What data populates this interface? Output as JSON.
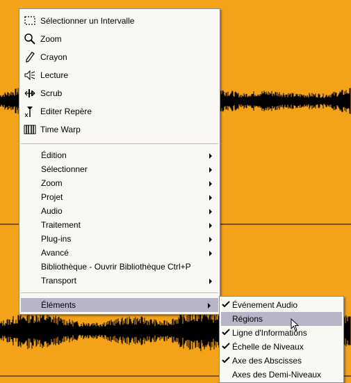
{
  "colors": {
    "waveform_bg": "#f5a21b",
    "waveform": "#000000",
    "menu_bg": "#f9f8f4",
    "highlight": "#b6b6c8"
  },
  "tools": [
    {
      "label": "Sélectionner un Intervalle",
      "icon": "range-select-icon"
    },
    {
      "label": "Zoom",
      "icon": "magnifier-icon"
    },
    {
      "label": "Crayon",
      "icon": "pencil-icon"
    },
    {
      "label": "Lecture",
      "icon": "speaker-icon"
    },
    {
      "label": "Scrub",
      "icon": "scrub-icon"
    },
    {
      "label": "Editer Repère",
      "icon": "marker-icon"
    },
    {
      "label": "Time Warp",
      "icon": "time-warp-icon"
    }
  ],
  "menu_items": [
    {
      "label": "Édition",
      "submenu": true
    },
    {
      "label": "Sélectionner",
      "submenu": true
    },
    {
      "label": "Zoom",
      "submenu": true
    },
    {
      "label": "Projet",
      "submenu": true
    },
    {
      "label": "Audio",
      "submenu": true
    },
    {
      "label": "Traitement",
      "submenu": true
    },
    {
      "label": "Plug-ins",
      "submenu": true
    },
    {
      "label": "Avancé",
      "submenu": true
    },
    {
      "label": "Bibliothèque - Ouvrir Bibliothèque",
      "shortcut": "Ctrl+P",
      "submenu": false
    },
    {
      "label": "Transport",
      "submenu": true
    }
  ],
  "elements_item": {
    "label": "Éléments",
    "submenu": true,
    "highlighted": true
  },
  "submenu_items": [
    {
      "label": "Événement Audio",
      "checked": true
    },
    {
      "label": "Régions",
      "checked": false,
      "highlighted": true
    },
    {
      "label": "Ligne d'Informations",
      "checked": true
    },
    {
      "label": "Échelle de Niveaux",
      "checked": true
    },
    {
      "label": "Axe des Abscisses",
      "checked": true
    },
    {
      "label": "Axes des Demi-Niveaux",
      "checked": false
    }
  ]
}
